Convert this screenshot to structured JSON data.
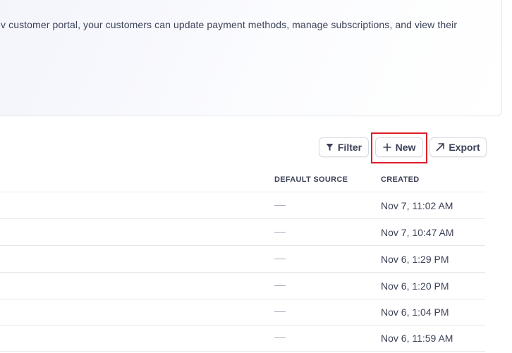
{
  "banner": {
    "text": "v customer portal, your customers can update payment methods, manage subscriptions, and view their"
  },
  "toolbar": {
    "filter_label": "Filter",
    "new_label": "New",
    "export_label": "Export"
  },
  "table": {
    "columns": [
      "DEFAULT SOURCE",
      "CREATED"
    ],
    "rows": [
      {
        "default_source": "—",
        "created": "Nov 7, 11:02 AM"
      },
      {
        "default_source": "—",
        "created": "Nov 7, 10:47 AM"
      },
      {
        "default_source": "—",
        "created": "Nov 6, 1:29 PM"
      },
      {
        "default_source": "—",
        "created": "Nov 6, 1:20 PM"
      },
      {
        "default_source": "—",
        "created": "Nov 6, 1:04 PM"
      },
      {
        "default_source": "—",
        "created": "Nov 6, 11:59 AM"
      }
    ]
  },
  "highlight_color": "#e11d2a"
}
